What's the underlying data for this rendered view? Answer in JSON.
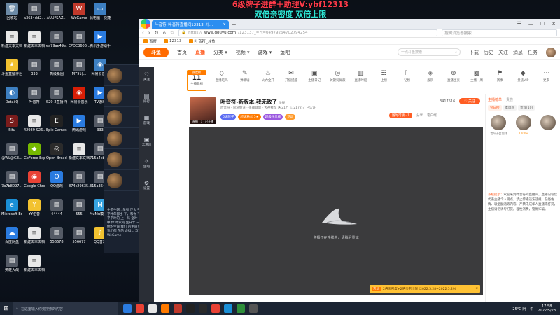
{
  "overlay": {
    "line1": "6级牌子进群＋助理V:ybf12313",
    "line2": "双倍亲密度  双倍上限"
  },
  "desktop_icons": [
    {
      "label": "回收站",
      "color": "#6c8aa6",
      "glyph": "🗑"
    },
    {
      "label": "a3634dd2...",
      "color": "#555b66",
      "glyph": "▤"
    },
    {
      "label": "AUUFSAZ...",
      "color": "#555b66",
      "glyph": "▤"
    },
    {
      "label": "WeGame",
      "color": "#c0392b",
      "glyph": "W"
    },
    {
      "label": "此电脑 - 快捷方式",
      "color": "#3d7fc1",
      "glyph": "▭"
    },
    {
      "label": "新建文本文档 (5)",
      "color": "#e7e7e7",
      "glyph": "≡"
    },
    {
      "label": "新建文本文档",
      "color": "#e7e7e7",
      "glyph": "≡"
    },
    {
      "label": "ea79ae49e...",
      "color": "#555b66",
      "glyph": "▤"
    },
    {
      "label": "EPDE3606...",
      "color": "#555b66",
      "glyph": "▤"
    },
    {
      "label": "腾讯手游助手",
      "color": "#2a7be0",
      "glyph": "▶"
    },
    {
      "label": "斗鱼直播伴侣",
      "color": "#f2c230",
      "glyph": "★"
    },
    {
      "label": "333",
      "color": "#555b66",
      "glyph": "▤"
    },
    {
      "label": "高级新图",
      "color": "#555b66",
      "glyph": "▤"
    },
    {
      "label": "M791(...",
      "color": "#555b66",
      "glyph": "▤"
    },
    {
      "label": "网易云音乐",
      "color": "#3d7fc1",
      "glyph": "◉"
    },
    {
      "label": "DetailQ",
      "color": "#3d7fc1",
      "glyph": "◐"
    },
    {
      "label": "叶音符",
      "color": "#555b66",
      "glyph": "▤"
    },
    {
      "label": "S29-2直播-叶音符",
      "color": "#555b66",
      "glyph": "▤"
    },
    {
      "label": "网易云音乐",
      "color": "#d81e06",
      "glyph": "◉"
    },
    {
      "label": "TV游戏",
      "color": "#2a7be0",
      "glyph": "▶"
    },
    {
      "label": "Sifu",
      "color": "#7a1c1c",
      "glyph": "S"
    },
    {
      "label": "42989-926...",
      "color": "#e7e7e7",
      "glyph": "≡"
    },
    {
      "label": "Epic Games Launcher",
      "color": "#222",
      "glyph": "E"
    },
    {
      "label": "腾讯游戏",
      "color": "#2a7be0",
      "glyph": "▶"
    },
    {
      "label": "333",
      "color": "#555b66",
      "glyph": "▤"
    },
    {
      "label": "@WL@GE...",
      "color": "#555b66",
      "glyph": "▤"
    },
    {
      "label": "GeForce Experience",
      "color": "#76b900",
      "glyph": "◆"
    },
    {
      "label": "Open Broadcast...",
      "color": "#2b2b2b",
      "glyph": "◎"
    },
    {
      "label": "新建文本文档 (3)",
      "color": "#e7e7e7",
      "glyph": "≡"
    },
    {
      "label": "715a4cbbe...",
      "color": "#555b66",
      "glyph": "▤"
    },
    {
      "label": "7b7b8097...",
      "color": "#555b66",
      "glyph": "▤"
    },
    {
      "label": "Google Chrome",
      "color": "#e94235",
      "glyph": "◉"
    },
    {
      "label": "QQ游戏",
      "color": "#2a7be0",
      "glyph": "Q"
    },
    {
      "label": "874c29635...",
      "color": "#555b66",
      "glyph": "▤"
    },
    {
      "label": "315a3648...",
      "color": "#555b66",
      "glyph": "▤"
    },
    {
      "label": "Microsoft Edge",
      "color": "#1a8fd6",
      "glyph": "e"
    },
    {
      "label": "YY语音",
      "color": "#f2c230",
      "glyph": "Y"
    },
    {
      "label": "44444",
      "color": "#555b66",
      "glyph": "▤"
    },
    {
      "label": "555",
      "color": "#555b66",
      "glyph": "▤"
    },
    {
      "label": "MuMu模拟器",
      "color": "#36a3e0",
      "glyph": "M"
    },
    {
      "label": "百度网盘",
      "color": "#2a7be0",
      "glyph": "☁"
    },
    {
      "label": "新建文本文档",
      "color": "#e7e7e7",
      "glyph": "≡"
    },
    {
      "label": "556678",
      "color": "#555b66",
      "glyph": "▤"
    },
    {
      "label": "556677",
      "color": "#555b66",
      "glyph": "▤"
    },
    {
      "label": "QQ音乐",
      "color": "#f2c230",
      "glyph": "♪"
    },
    {
      "label": "英雄大战",
      "color": "#555b66",
      "glyph": "▤"
    },
    {
      "label": "新建文本文档 (4)",
      "color": "#e7e7e7",
      "glyph": "≡"
    }
  ],
  "sidechat": {
    "text": "十是牛网...单号 正太 平平叶年都出 了，和你 不平平叶的 上一局 全叶 不中 你 叶家的 生日卡 三叶 你的生命 我们 的生命！我们都 在的 虚拟 ，欢迎 WeGame"
  },
  "browser": {
    "tab_title": "叶音符_叶音符直播间12313_斗...",
    "tab_close": "×",
    "new_tab": "+",
    "window_controls": [
      "☰",
      "—",
      "☐",
      "✕"
    ],
    "nav_icons": [
      "‹",
      "›",
      "↻",
      "⌂",
      "☆"
    ],
    "url_scheme": "https://",
    "url_host": "www.douyu.com",
    "url_path": "/123137_=?t=0497926470279425​4",
    "addr_search_placeholder": "搜狗浏览器搜索…",
    "bookmarks": [
      "百度",
      "12313",
      "叶音符_斗鱼"
    ]
  },
  "site": {
    "logo_text": "斗鱼",
    "nav": [
      "首页",
      "直播",
      "分类 ▾",
      "视频 ▾",
      "游戏 ▾",
      "鱼吧"
    ],
    "active_nav": "直播",
    "search_placeholder": "一点斗鱼搜索",
    "user_icons": [
      "下载",
      "历史",
      "关注",
      "消息",
      "任务"
    ],
    "sidebar": [
      {
        "glyph": "♡",
        "label": "关注"
      },
      {
        "glyph": "▤",
        "label": "排行"
      },
      {
        "glyph": "▦",
        "label": "游戏"
      },
      {
        "glyph": "▣",
        "label": "云游戏"
      },
      {
        "glyph": "✧",
        "label": "鱼吧"
      },
      {
        "glyph": "⚙",
        "label": "设置"
      }
    ],
    "rank": {
      "tag": "热度榜",
      "number": "11",
      "label": "主播日榜"
    }
  },
  "features": [
    {
      "glyph": "◇",
      "label": "直播吃鸡"
    },
    {
      "glyph": "✎",
      "label": "弹幕墙"
    },
    {
      "glyph": "♨",
      "label": "火力全开"
    },
    {
      "glyph": "✉",
      "label": "开播提醒"
    },
    {
      "glyph": "▣",
      "label": "主播日记"
    },
    {
      "glyph": "◎",
      "label": "关键词屏蔽"
    },
    {
      "glyph": "▥",
      "label": "直播时延"
    },
    {
      "glyph": "☷",
      "label": "上榜"
    },
    {
      "glyph": "⚐",
      "label": "钻粉"
    },
    {
      "glyph": "◈",
      "label": "舰队"
    },
    {
      "glyph": "⊕",
      "label": "直播主页"
    },
    {
      "glyph": "▩",
      "label": "主播一周"
    },
    {
      "glyph": "⚑",
      "label": "赛事"
    },
    {
      "glyph": "◆",
      "label": "贵族VIP"
    },
    {
      "glyph": "⋯",
      "label": "更多"
    }
  ],
  "stream": {
    "title": "叶音符-新版本,我无敌了",
    "report": "举报",
    "meta": "叶音符 · 同游频道 · 英雄联盟 · 大神推荐   ◔ 21万   ♨ 2172   ✓ 已认证",
    "tags": [
      {
        "text": "6级牌子",
        "color": "#5b6cf2"
      },
      {
        "text": "超级粉丝 5★",
        "color": "#ff7a00"
      },
      {
        "text": "超级粉丝榜",
        "color": "#9b59e0"
      },
      {
        "text": "活动",
        "color": "#ff9a2a"
      }
    ],
    "live_label": "直播 · 1 · 已开播",
    "viewer_count": "3417516",
    "follow_label": "♡ 关注",
    "right_pill": "随时可领 · 1",
    "right_links": [
      "分享",
      "客户端"
    ],
    "loading_text": "主播正在连线中，请稍后重试",
    "banner_badge": "活动",
    "banner_text": "2倍亲密度+2倍亲密上限 (2022.5.28~2022.5.29)",
    "banner_close": "×"
  },
  "right_panel": {
    "tabs": [
      "主播榜单",
      "贵族"
    ],
    "subtabs": [
      "今日榜",
      "本周榜",
      "贵宾(10)"
    ],
    "ranks": [
      {
        "name": "看叶子会发财",
        "value": ""
      },
      {
        "name": "",
        "value": "1000w"
      },
      {
        "name": "",
        "value": ""
      }
    ],
    "sysmsg_key": "系统提示：",
    "sysmsg": "欢迎来到叶音符的直播间，直播内容仅代表主播个人观点，禁止传播违法违规、低俗色情、吸烟酗酒等内容。严禁未成年人直播或打赏，主播请勿诱导打赏。理性消费，警惕诈骗。"
  },
  "taskbar": {
    "search_placeholder": "在这里输入你要搜索的内容",
    "app_colors": [
      "#2a7be0",
      "#e94235",
      "#e7e7e7",
      "#ff7a00",
      "#c0392b",
      "#222",
      "#2a2a2a",
      "#e94235",
      "#1a8fd6",
      "#2f8f3a",
      "#555"
    ],
    "weather": "25°C 阴",
    "lang": "中",
    "time": "17:58",
    "date": "2022/5/28"
  }
}
